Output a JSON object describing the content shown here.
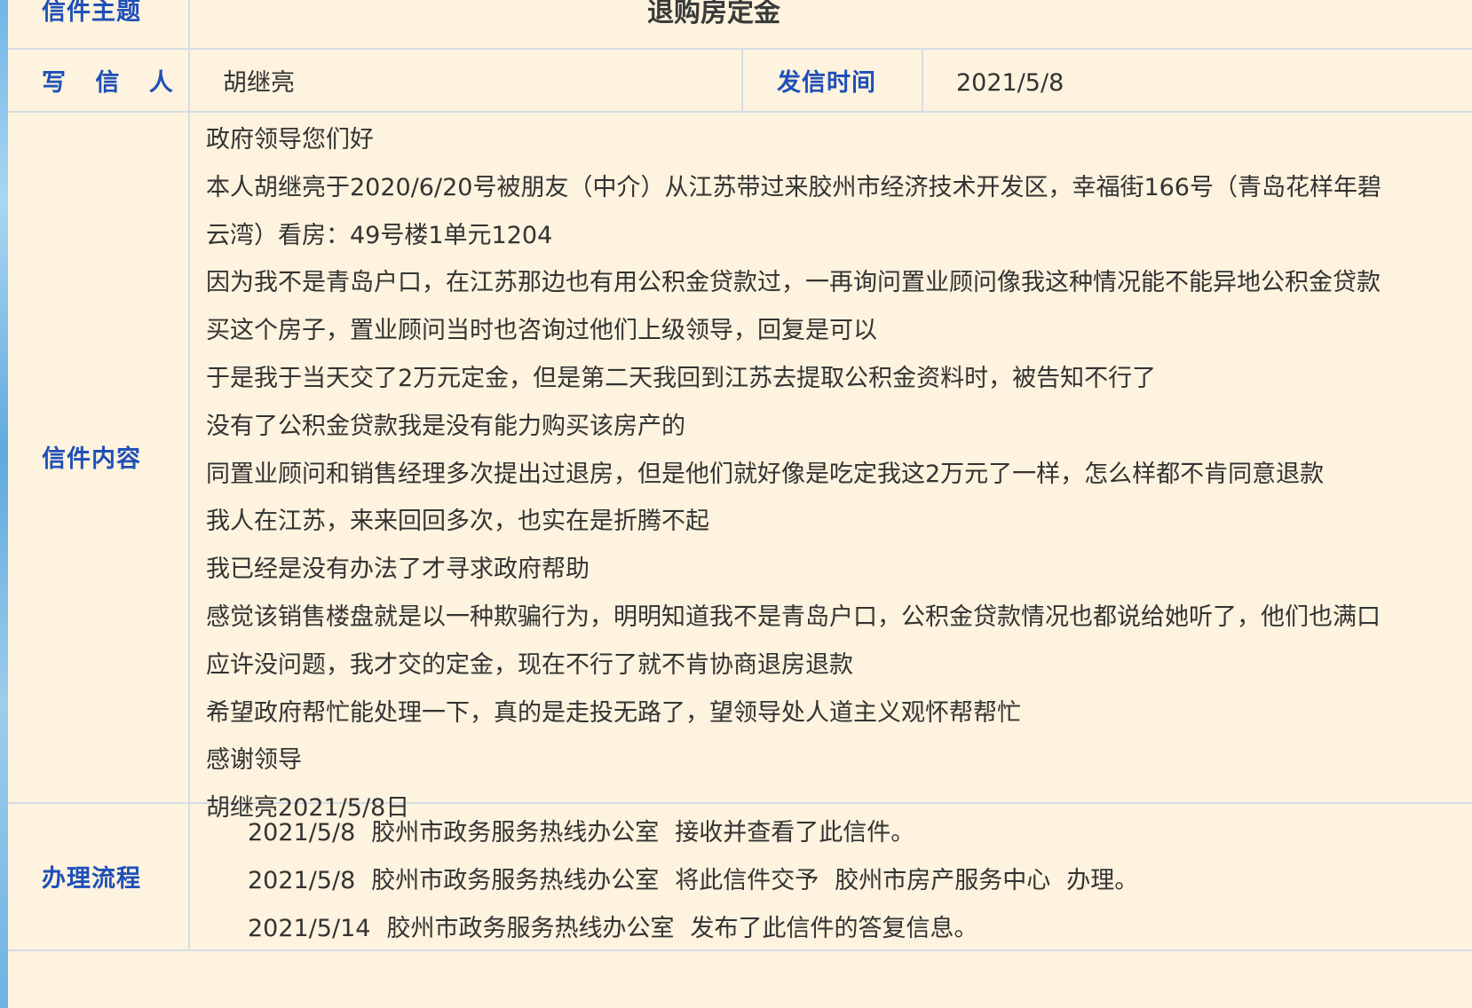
{
  "subject": {
    "label": "信件主题",
    "value": "退购房定金"
  },
  "writer": {
    "label": "写 信 人",
    "value": "胡继亮"
  },
  "send_time": {
    "label": "发信时间",
    "value": "2021/5/8"
  },
  "content": {
    "label": "信件内容",
    "lines": [
      "政府领导您们好",
      "本人胡继亮于2020/6/20号被朋友（中介）从江苏带过来胶州市经济技术开发区，幸福街166号（青岛花样年碧",
      "云湾）看房：49号楼1单元1204",
      "因为我不是青岛户口，在江苏那边也有用公积金贷款过，一再询问置业顾问像我这种情况能不能异地公积金贷款",
      "买这个房子，置业顾问当时也咨询过他们上级领导，回复是可以",
      "于是我于当天交了2万元定金，但是第二天我回到江苏去提取公积金资料时，被告知不行了",
      "没有了公积金贷款我是没有能力购买该房产的",
      "同置业顾问和销售经理多次提出过退房，但是他们就好像是吃定我这2万元了一样，怎么样都不肯同意退款",
      "我人在江苏，来来回回多次，也实在是折腾不起",
      "我已经是没有办法了才寻求政府帮助",
      "感觉该销售楼盘就是以一种欺骗行为，明明知道我不是青岛户口，公积金贷款情况也都说给她听了，他们也满口",
      "应许没问题，我才交的定金，现在不行了就不肯协商退房退款",
      "希望政府帮忙能处理一下，真的是走投无路了，望领导处人道主义观怀帮帮忙",
      "感谢领导",
      "胡继亮2021/5/8日"
    ]
  },
  "process": {
    "label": "办理流程",
    "steps": [
      {
        "date": "2021/5/8",
        "office": "胶州市政务服务热线办公室",
        "action": "接收并查看了此信件。"
      },
      {
        "date": "2021/5/8",
        "office": "胶州市政务服务热线办公室",
        "action": "将此信件交予",
        "target": "胶州市房产服务中心",
        "suffix": "办理。"
      },
      {
        "date": "2021/5/14",
        "office": "胶州市政务服务热线办公室",
        "action": "发布了此信件的答复信息。"
      }
    ]
  },
  "colors": {
    "background": "#fdf3de",
    "label": "#1f4fb8",
    "text": "#333333",
    "grid": "#d6dde3"
  }
}
